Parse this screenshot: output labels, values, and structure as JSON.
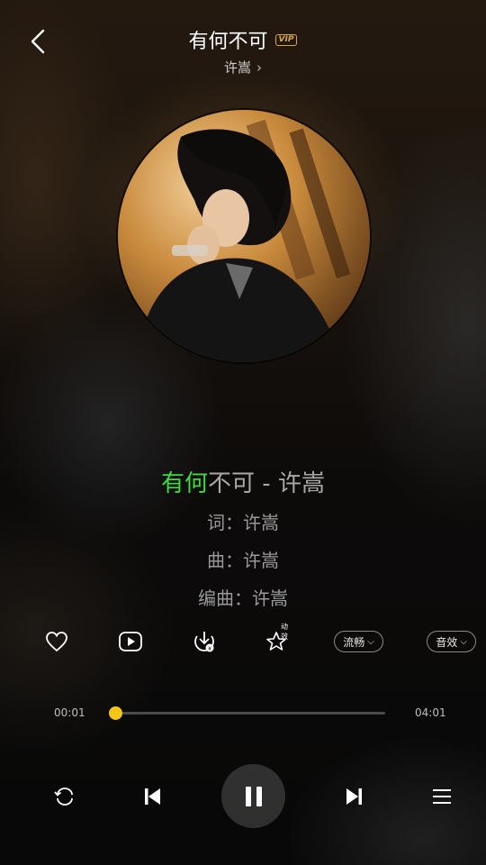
{
  "header": {
    "song_title": "有何不可",
    "vip_badge": "VIP",
    "artist": "许嵩"
  },
  "lyrics": {
    "current_highlighted": "有何",
    "current_rest": "不可 - 许嵩",
    "lines": [
      "词：许嵩",
      "曲：许嵩",
      "编曲：许嵩"
    ]
  },
  "actions": {
    "effect_tag": "动效",
    "quality_label": "流畅",
    "sound_effect_label": "音效"
  },
  "player": {
    "elapsed": "00:01",
    "duration": "04:01",
    "progress_fraction": 0.004
  },
  "icons": {
    "back": "chevron-left-icon",
    "like": "heart-icon",
    "video": "play-circle-icon",
    "download": "download-icon",
    "effects": "star-sparkle-icon",
    "repeat": "repeat-icon",
    "prev": "skip-previous-icon",
    "pause": "pause-icon",
    "next": "skip-next-icon",
    "playlist": "playlist-icon"
  },
  "colors": {
    "lyric_highlight": "#3ddc3d",
    "progress_accent": "#f5c518",
    "vip_gold": "#d9a74a"
  }
}
